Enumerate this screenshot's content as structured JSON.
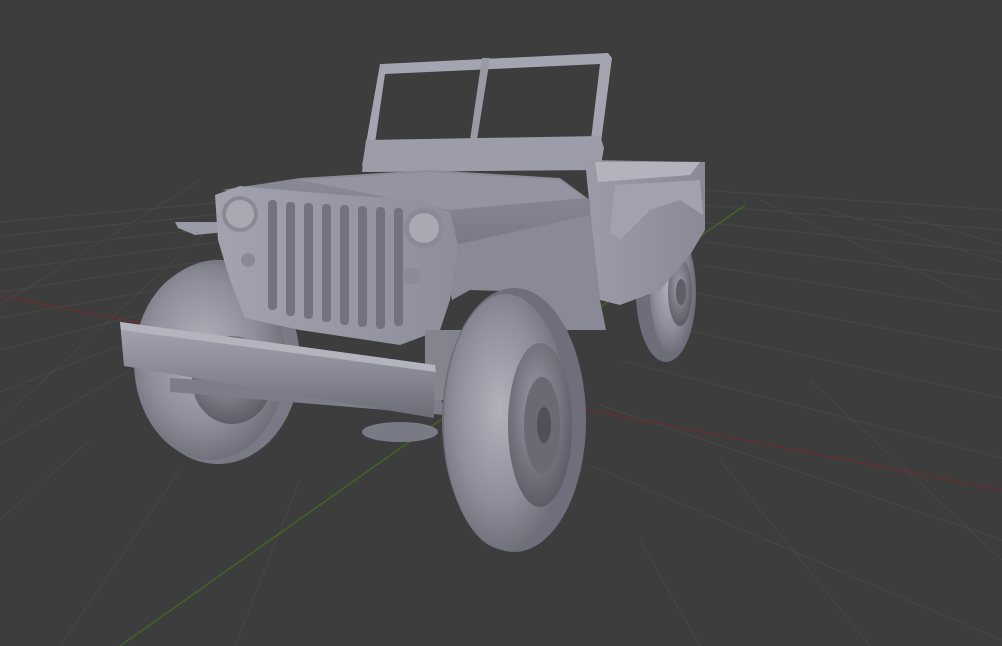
{
  "viewport": {
    "background_color": "#3d3d3d",
    "grid_color": "#474747",
    "x_axis_color": "#6b2e2e",
    "y_axis_color": "#3f6b22",
    "grid_visible": true,
    "shading": "solid"
  },
  "scene": {
    "objects": [
      {
        "type": "mesh",
        "subject": "military jeep",
        "material_color": "#9a9aa6"
      }
    ]
  }
}
